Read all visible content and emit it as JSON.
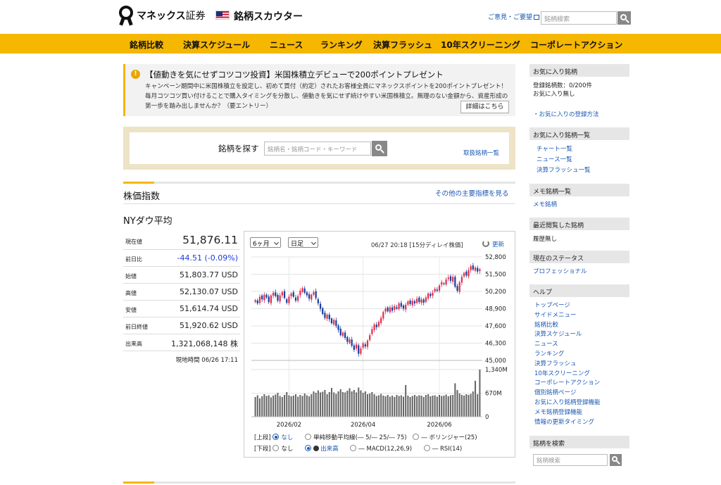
{
  "header": {
    "logo_brand": "マネックス",
    "logo_suffix": "証券",
    "app_title": "銘柄スカウター",
    "feedback": "ご意見・ご要望",
    "search_placeholder": "銘柄検索"
  },
  "nav": {
    "items": [
      "銘柄比較",
      "決算スケジュール",
      "ニュース",
      "ランキング",
      "決算フラッシュ",
      "10年スクリーニング",
      "コーポレートアクション"
    ]
  },
  "campaign": {
    "title": "【値動きを気にせずコツコツ投資】米国株積立デビューで200ポイントプレゼント",
    "body": "キャンペーン期間中に米国株積立を設定し、初めて買付（約定）されたお客様全員にマネックスポイントを200ポイントプレゼント！毎月コツコツ買い付けることで購入タイミングを分散し、値動きを気にせず続けやすい米国株積立。無理のない金額から、資産形成の第一歩を踏み出しませんか？（要エントリー）",
    "more_button": "詳細はこちら"
  },
  "symbol_search": {
    "label": "銘柄を探す",
    "placeholder": "銘柄名・銘柄コード・キーワード",
    "list_link": "取扱銘柄一覧"
  },
  "section": {
    "title": "株価指数",
    "more_link": "その他の主要指標を見る"
  },
  "index": {
    "name": "NYダウ平均",
    "rows": [
      {
        "label": "現在値",
        "value": "51,876.11"
      },
      {
        "label": "前日比",
        "value": "-44.51 (-0.09%)"
      },
      {
        "label": "始値",
        "value": "51,803.77 USD"
      },
      {
        "label": "高値",
        "value": "52,130.07 USD"
      },
      {
        "label": "安値",
        "value": "51,614.74 USD"
      },
      {
        "label": "前日終値",
        "value": "51,920.62 USD"
      },
      {
        "label": "出来高",
        "value": "1,321,068,148 株"
      }
    ],
    "timestamp": "現地時間 06/26 17:11"
  },
  "chart_controls": {
    "period": "6ヶ月",
    "interval": "日足",
    "stamp": "06/27 20:18 [15分ディレイ株価]",
    "refresh": "更新"
  },
  "legend": {
    "upper_label": "[上段]",
    "upper_none": "なし",
    "upper_sma": "単純移動平均線(― 5/― 25/― 75)",
    "upper_boll": "― ボリンジャー(25)",
    "lower_label": "[下段]",
    "lower_none": "なし",
    "lower_volume": "出来高",
    "lower_macd": "― MACD(12,26,9)",
    "lower_rsi": "― RSI(14)"
  },
  "sidebar": {
    "fav_head": "お気に入り銘柄",
    "fav_count": "登録銘柄数：0/200件",
    "fav_none": "お気に入り無し",
    "fav_howto": "・お気に入りの登録方法",
    "favlist_head": "お気に入り銘柄一覧",
    "favlist_links": [
      "チャート一覧",
      "ニュース一覧",
      "決算フラッシュ一覧"
    ],
    "memo_head": "メモ銘柄一覧",
    "memo_link": "メモ銘柄",
    "recent_head": "最近閲覧した銘柄",
    "recent_none": "履歴無し",
    "status_head": "現在のステータス",
    "status_link": "プロフェッショナル",
    "help_head": "ヘルプ",
    "help_links": [
      "トップページ",
      "サイドメニュー",
      "銘柄比較",
      "決算スケジュール",
      "ニュース",
      "ランキング",
      "決算フラッシュ",
      "10年スクリーニング",
      "コーポレートアクション",
      "個別銘柄ページ",
      "お気に入り銘柄登録機能",
      "メモ銘柄登録機能",
      "情報の更新タイミング"
    ],
    "search_head": "銘柄を検索",
    "search_placeholder": "銘柄検索"
  },
  "colors": {
    "accent": "#f5b700",
    "up": "#e0304e",
    "down": "#1a3e9e",
    "link": "#1a57b5"
  },
  "chart_data": {
    "type": "candlestick",
    "price_ticks": [
      "52,800",
      "51,500",
      "50,200",
      "48,900",
      "47,600",
      "46,300",
      "45,000"
    ],
    "price_range": [
      45000,
      52800
    ],
    "volume_ticks": [
      "1,340M",
      "670M",
      "0"
    ],
    "volume_range": [
      0,
      1340
    ],
    "x_labels": [
      "2026/02",
      "2026/04",
      "2026/06"
    ],
    "closes": [
      49550,
      49300,
      49800,
      49600,
      49950,
      49750,
      49400,
      49900,
      50100,
      49850,
      49500,
      49900,
      50150,
      49700,
      49350,
      49800,
      50050,
      49800,
      49500,
      49850,
      50250,
      50450,
      50100,
      49900,
      49650,
      49950,
      50150,
      49700,
      49300,
      48900,
      48500,
      48200,
      48450,
      48100,
      47800,
      48050,
      47600,
      47300,
      46900,
      47100,
      46700,
      46400,
      46600,
      46100,
      45800,
      46200,
      45500,
      45900,
      46300,
      46050,
      46500,
      46900,
      47350,
      47700,
      47500,
      47900,
      48200,
      48650,
      48900,
      48700,
      49000,
      48750,
      49100,
      48900,
      49300,
      49050,
      48900,
      49200,
      49450,
      49250,
      49500,
      49300,
      49650,
      49400,
      49600,
      49350,
      49750,
      50050,
      49850,
      50100,
      50400,
      50250,
      50650,
      50900,
      50750,
      51100,
      51250,
      51000,
      51300,
      50550,
      50250,
      50900,
      51300,
      51600,
      51400,
      51800,
      52100,
      51850,
      52000,
      51700,
      51876
    ],
    "volumes": [
      560,
      610,
      520,
      580,
      640,
      590,
      610,
      550,
      600,
      630,
      680,
      590,
      560,
      620,
      700,
      610,
      580,
      600,
      640,
      570,
      620,
      590,
      660,
      610,
      580,
      640,
      720,
      680,
      750,
      690,
      710,
      760,
      640,
      700,
      820,
      690,
      650,
      720,
      780,
      700,
      690,
      740,
      810,
      720,
      760,
      690,
      830,
      750,
      680,
      720,
      640,
      660,
      700,
      640,
      590,
      610,
      650,
      600,
      580,
      620,
      570,
      600,
      560,
      620,
      590,
      610,
      570,
      900,
      600,
      560,
      590,
      620,
      580,
      610,
      600,
      560,
      620,
      640,
      580,
      600,
      610,
      570,
      620,
      590,
      600,
      630,
      580,
      610,
      620,
      950,
      760,
      660,
      620,
      600,
      640,
      620,
      650,
      720,
      1020,
      640,
      1340
    ]
  }
}
